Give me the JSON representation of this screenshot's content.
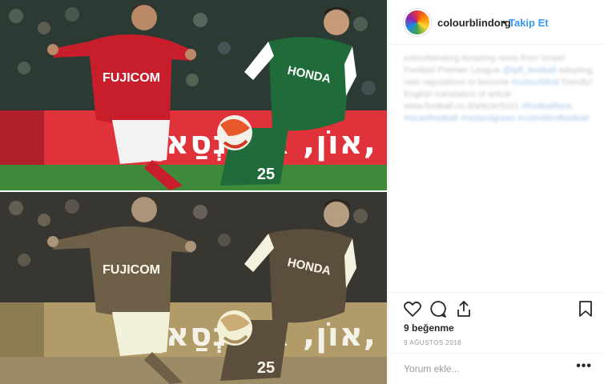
{
  "post": {
    "ad_text": "אוֹן, אוֹנוּנְסַאן,",
    "ad_text_bottom": "אוֹן, אוֹנוּנְסַאן,",
    "red_player": {
      "sponsor": "FUJICOM"
    },
    "green_player": {
      "sponsor": "HONDA",
      "number": "25"
    }
  },
  "header": {
    "username": "colourblindorg",
    "separator": "•",
    "follow_label": "Takip Et"
  },
  "caption": {
    "text": "colourblindorg Amazing news from Israel! Football Premier League",
    "tag1": "@ipfl_football",
    "text2": "adopting new regulations to become",
    "tag2": "#colourblind",
    "text3": "friendly! English translation of article www.football.co.il/article/9101",
    "tag3": "#footballfans #israelfootball #redandgreen #colorblindfootball"
  },
  "icons": {
    "like": "heart-icon",
    "comment": "comment-icon",
    "share": "share-icon",
    "save": "bookmark-icon"
  },
  "stats": {
    "likes": "9 beğenme",
    "date": "9 AĞUSTOS 2018"
  },
  "comment": {
    "placeholder": "Yorum ekle...",
    "more": "•••"
  },
  "colors": {
    "accent": "#3897f0",
    "red_team": "#c81e2c",
    "green_team": "#1f6b3a",
    "ad_board": "#e0323a"
  }
}
